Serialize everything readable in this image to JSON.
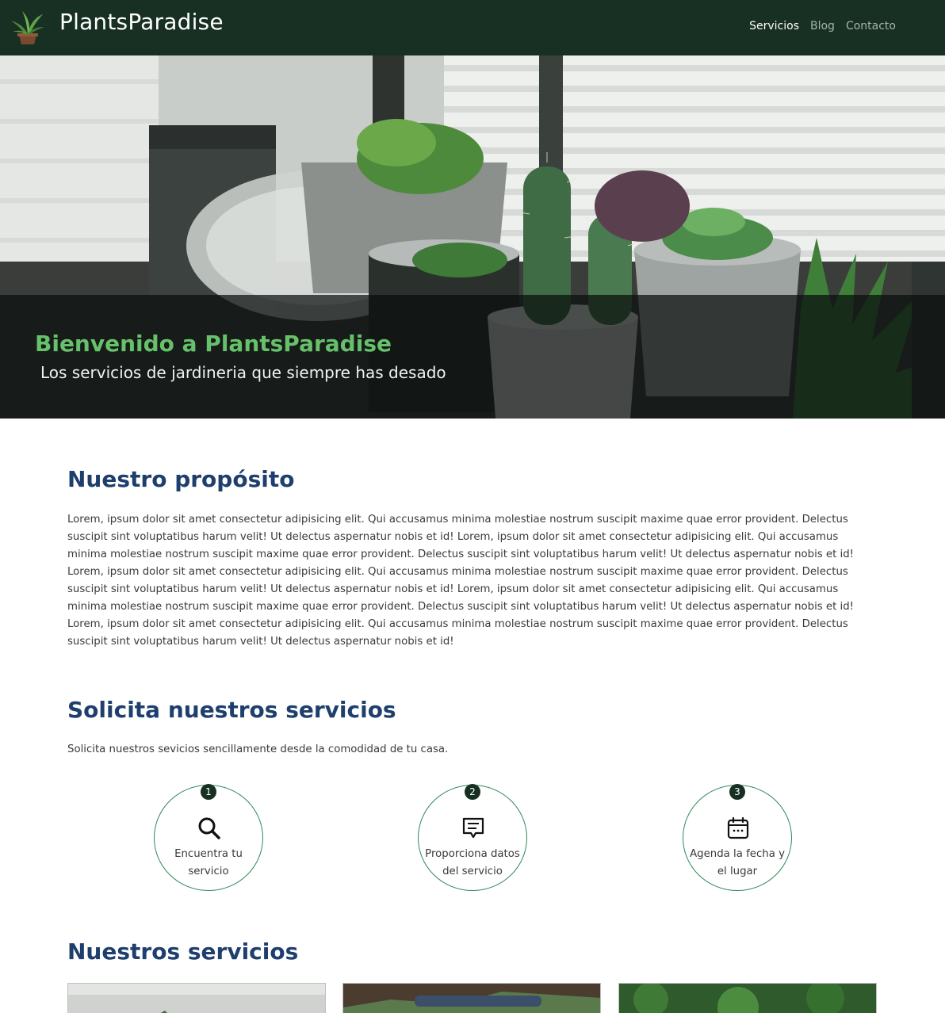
{
  "navbar": {
    "brand_name": "PlantsParadise",
    "logo_icon": "potted-plant-logo",
    "links": [
      {
        "label": "Servicios",
        "active": true
      },
      {
        "label": "Blog",
        "active": false
      },
      {
        "label": "Contacto",
        "active": false
      }
    ]
  },
  "hero": {
    "title": "Bienvenido a PlantsParadise",
    "subtitle": "Los servicios de jardineria que siempre has desado"
  },
  "purpose": {
    "title": "Nuestro propósito",
    "text": "Lorem, ipsum dolor sit amet consectetur adipisicing elit. Qui accusamus minima molestiae nostrum suscipit maxime quae error provident. Delectus suscipit sint voluptatibus harum velit! Ut delectus aspernatur nobis et id! Lorem, ipsum dolor sit amet consectetur adipisicing elit. Qui accusamus minima molestiae nostrum suscipit maxime quae error provident. Delectus suscipit sint voluptatibus harum velit! Ut delectus aspernatur nobis et id! Lorem, ipsum dolor sit amet consectetur adipisicing elit. Qui accusamus minima molestiae nostrum suscipit maxime quae error provident. Delectus suscipit sint voluptatibus harum velit! Ut delectus aspernatur nobis et id! Lorem, ipsum dolor sit amet consectetur adipisicing elit. Qui accusamus minima molestiae nostrum suscipit maxime quae error provident. Delectus suscipit sint voluptatibus harum velit! Ut delectus aspernatur nobis et id! Lorem, ipsum dolor sit amet consectetur adipisicing elit. Qui accusamus minima molestiae nostrum suscipit maxime quae error provident. Delectus suscipit sint voluptatibus harum velit! Ut delectus aspernatur nobis et id!"
  },
  "request": {
    "title": "Solicita nuestros servicios",
    "text": "Solicita nuestros sevicios sencillamente desde la comodidad de tu casa.",
    "steps": [
      {
        "number": "1",
        "icon": "search-icon",
        "label": "Encuentra tu servicio"
      },
      {
        "number": "2",
        "icon": "message-icon",
        "label": "Proporciona datos del servicio"
      },
      {
        "number": "3",
        "icon": "calendar-icon",
        "label": "Agenda la fecha y el lugar"
      }
    ]
  },
  "services": {
    "title": "Nuestros servicios"
  },
  "colors": {
    "navbar_bg": "#183023",
    "heading": "#1e3f6e",
    "hero_title": "#66c16a",
    "step_border": "#2f8a5a"
  }
}
